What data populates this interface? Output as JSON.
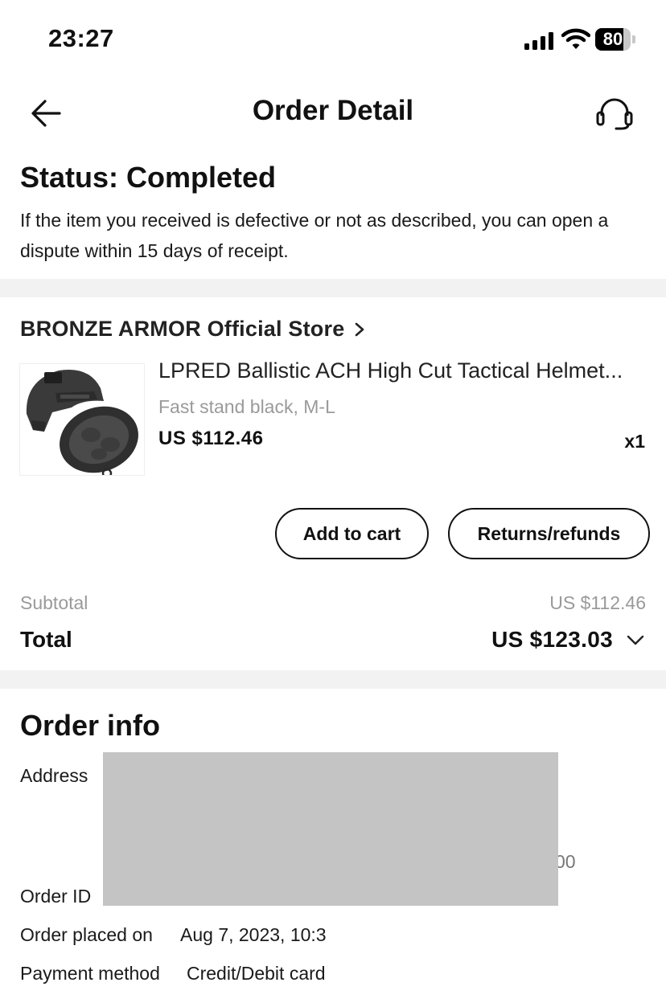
{
  "status_bar": {
    "time": "23:27",
    "battery": "80",
    "battery_level": 0.8
  },
  "header": {
    "title": "Order Detail"
  },
  "status": {
    "title": "Status: Completed",
    "description": "If the item you received is defective or not as described, you can open a dispute within 15 days of receipt."
  },
  "store": {
    "name": "BRONZE ARMOR Official Store"
  },
  "item": {
    "title": "LPRED Ballistic ACH High Cut Tactical Helmet...",
    "variant": "Fast stand black, M-L",
    "price": "US $112.46",
    "quantity": "x1"
  },
  "actions": {
    "add_to_cart": "Add to cart",
    "returns_refunds": "Returns/refunds"
  },
  "summary": {
    "subtotal_label": "Subtotal",
    "subtotal_value": "US $112.46",
    "total_label": "Total",
    "total_value": "US $123.03"
  },
  "order_info": {
    "title": "Order info",
    "address_label": "Address",
    "address_partial_visible": "00",
    "order_id_label": "Order ID",
    "placed_label": "Order placed on",
    "placed_value": "Aug 7, 2023, 10:3",
    "payment_label": "Payment method",
    "payment_value": "Credit/Debit card"
  },
  "colors": {
    "text": "#111111",
    "muted": "#9a9a9a",
    "divider": "#f2f2f2",
    "redaction": "#c4c4c4"
  }
}
